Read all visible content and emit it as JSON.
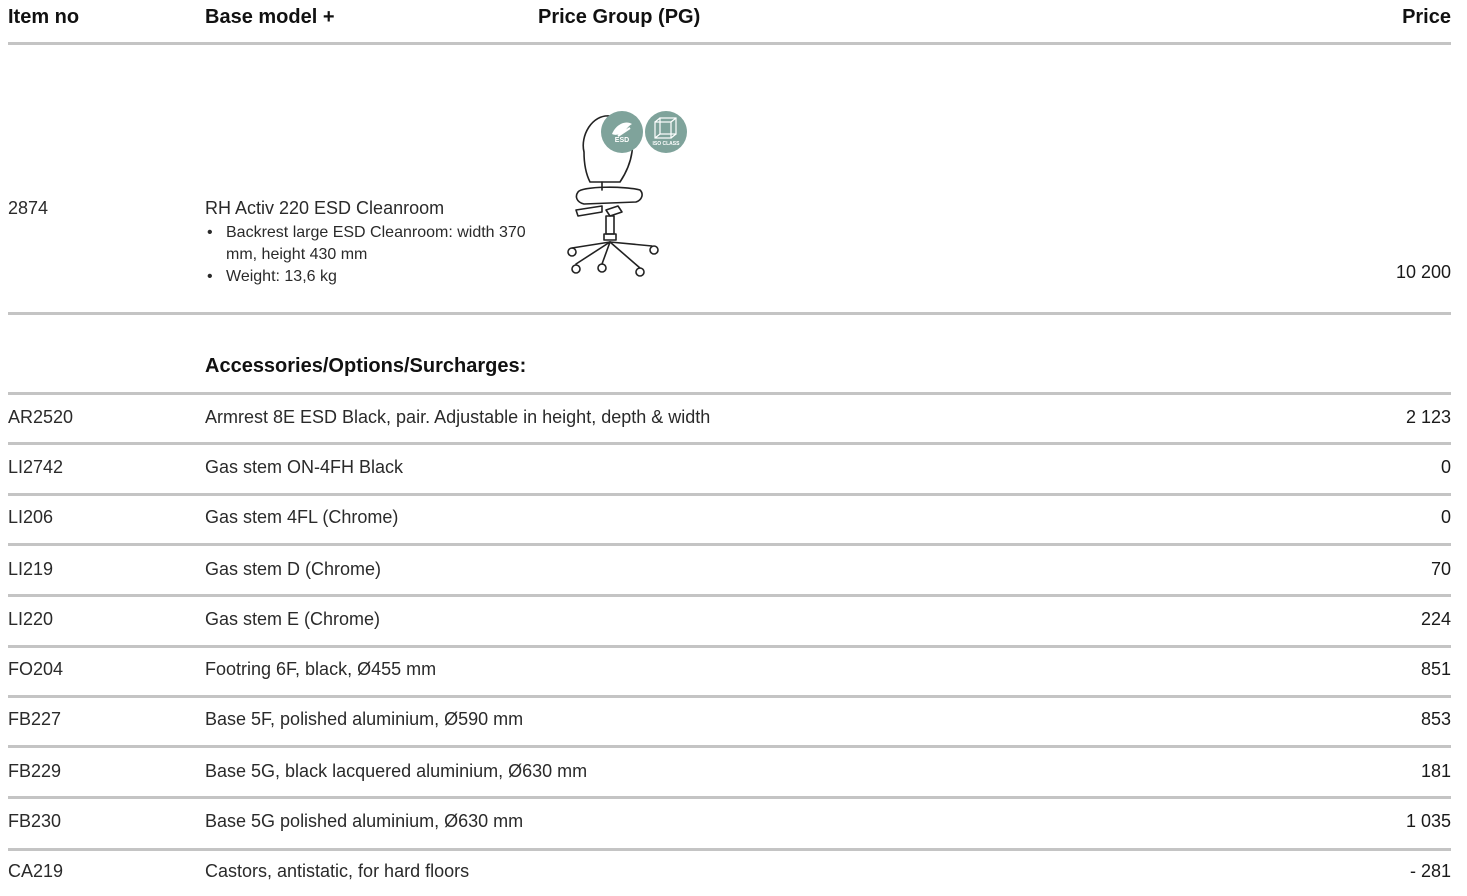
{
  "header": {
    "item_no": "Item no",
    "base_model": "Base model +",
    "price_group": "Price Group (PG)",
    "price": "Price"
  },
  "product": {
    "item_no": "2874",
    "name": "RH Activ 220 ESD Cleanroom",
    "bullets": [
      "Backrest large ESD Cleanroom: width 370 mm, height 430 mm",
      "Weight: 13,6 kg"
    ],
    "price": "10 200",
    "badges": {
      "esd": "ESD",
      "iso": "ISO CLASS"
    },
    "badge_color": "#7fa39b",
    "image_icon": "office-chair-icon"
  },
  "accessories": {
    "title": "Accessories/Options/Surcharges:",
    "rows": [
      {
        "code": "AR2520",
        "desc": "Armrest 8E ESD Black, pair. Adjustable in height, depth & width",
        "price": "2 123"
      },
      {
        "code": "LI2742",
        "desc": "Gas stem ON-4FH Black",
        "price": "0"
      },
      {
        "code": "LI206",
        "desc": "Gas stem 4FL (Chrome)",
        "price": "0"
      },
      {
        "code": "LI219",
        "desc": "Gas stem D (Chrome)",
        "price": "70"
      },
      {
        "code": "LI220",
        "desc": "Gas stem E (Chrome)",
        "price": "224"
      },
      {
        "code": "FO204",
        "desc": "Footring 6F, black, Ø455 mm",
        "price": "851"
      },
      {
        "code": "FB227",
        "desc": "Base 5F, polished aluminium, Ø590 mm",
        "price": "853"
      },
      {
        "code": "FB229",
        "desc": "Base 5G, black lacquered aluminium, Ø630 mm",
        "price": "181"
      },
      {
        "code": "FB230",
        "desc": "Base 5G polished aluminium, Ø630 mm",
        "price": "1 035"
      },
      {
        "code": "CA219",
        "desc": "Castors, antistatic, for hard floors",
        "price": "- 281"
      }
    ]
  }
}
